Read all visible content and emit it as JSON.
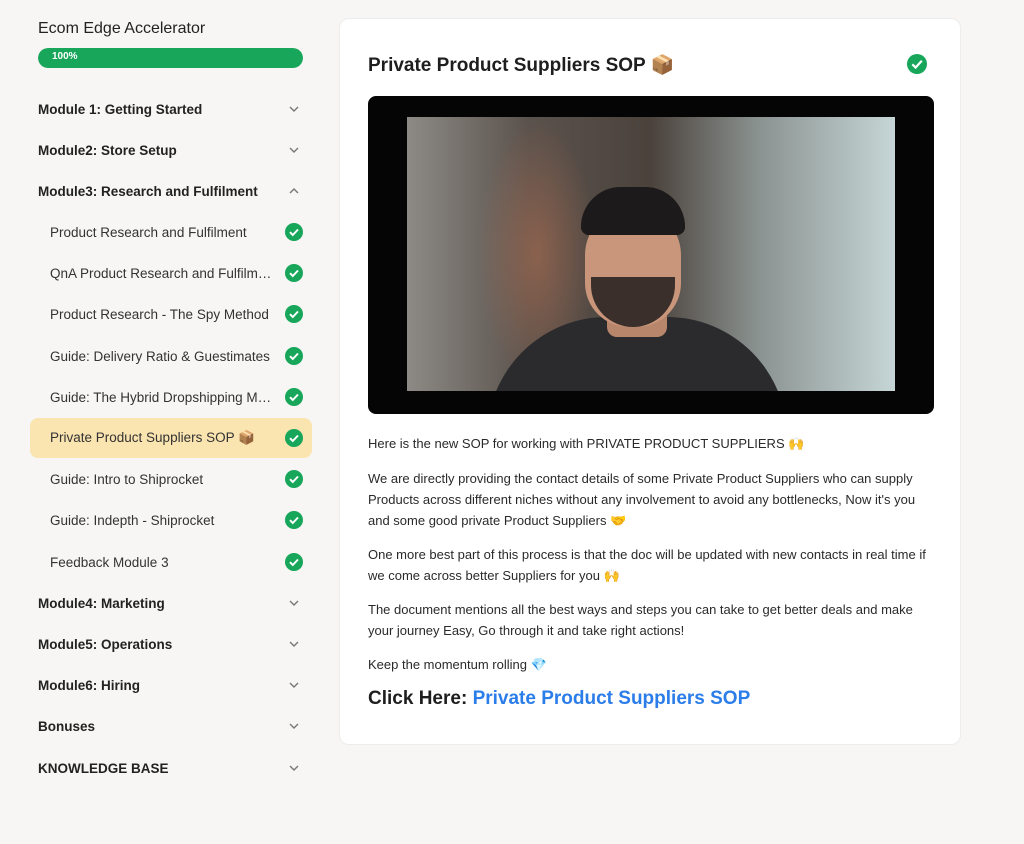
{
  "course": {
    "title": "Ecom Edge Accelerator",
    "progress_label": "100%",
    "progress_fraction": 1.0
  },
  "sidebar": {
    "modules": [
      {
        "label": "Module 1: Getting Started",
        "expanded": false
      },
      {
        "label": "Module2: Store Setup",
        "expanded": false
      },
      {
        "label": "Module3: Research and Fulfilment",
        "expanded": true
      },
      {
        "label": "Module4: Marketing",
        "expanded": false
      },
      {
        "label": "Module5: Operations",
        "expanded": false
      },
      {
        "label": "Module6: Hiring",
        "expanded": false
      },
      {
        "label": "Bonuses",
        "expanded": false
      },
      {
        "label": "KNOWLEDGE BASE",
        "expanded": false
      }
    ],
    "lessons": [
      {
        "label": "Product Research and Fulfilment",
        "completed": true
      },
      {
        "label": "QnA Product Research and Fulfilment",
        "completed": true
      },
      {
        "label": "Product Research - The Spy Method",
        "completed": true
      },
      {
        "label": "Guide: Delivery Ratio & Guestimates",
        "completed": true
      },
      {
        "label": "Guide: The Hybrid Dropshipping Model",
        "completed": true
      },
      {
        "label": "Private Product Suppliers SOP 📦",
        "completed": true,
        "active": true
      },
      {
        "label": "Guide: Intro to Shiprocket",
        "completed": true
      },
      {
        "label": "Guide: Indepth - Shiprocket",
        "completed": true
      },
      {
        "label": "Feedback Module 3",
        "completed": true
      }
    ]
  },
  "lesson": {
    "title": "Private Product Suppliers SOP 📦",
    "completed": true,
    "paragraphs": [
      "Here is the new SOP for working with PRIVATE PRODUCT SUPPLIERS 🙌",
      "We are directly providing the contact details of some Private Product Suppliers who can supply Products across different niches without any involvement to avoid any bottlenecks, Now it's you and some good private Product Suppliers 🤝",
      "One more best part of this process is that the doc will be updated with new contacts in real time if we come across better Suppliers for you 🙌",
      "The document mentions all the best ways and steps you can take to get better deals and make your journey Easy, Go through it and take right actions!",
      "Keep the momentum rolling 💎"
    ],
    "cta_prefix": "Click Here:",
    "cta_link": "Private Product Suppliers SOP"
  },
  "colors": {
    "accent_green": "#17a65a",
    "active_lesson_bg": "#fae4b0",
    "link_blue": "#2b7de9"
  },
  "icons": {
    "module_toggle": "chevron-icon",
    "lesson_status": "check-circle-icon"
  }
}
